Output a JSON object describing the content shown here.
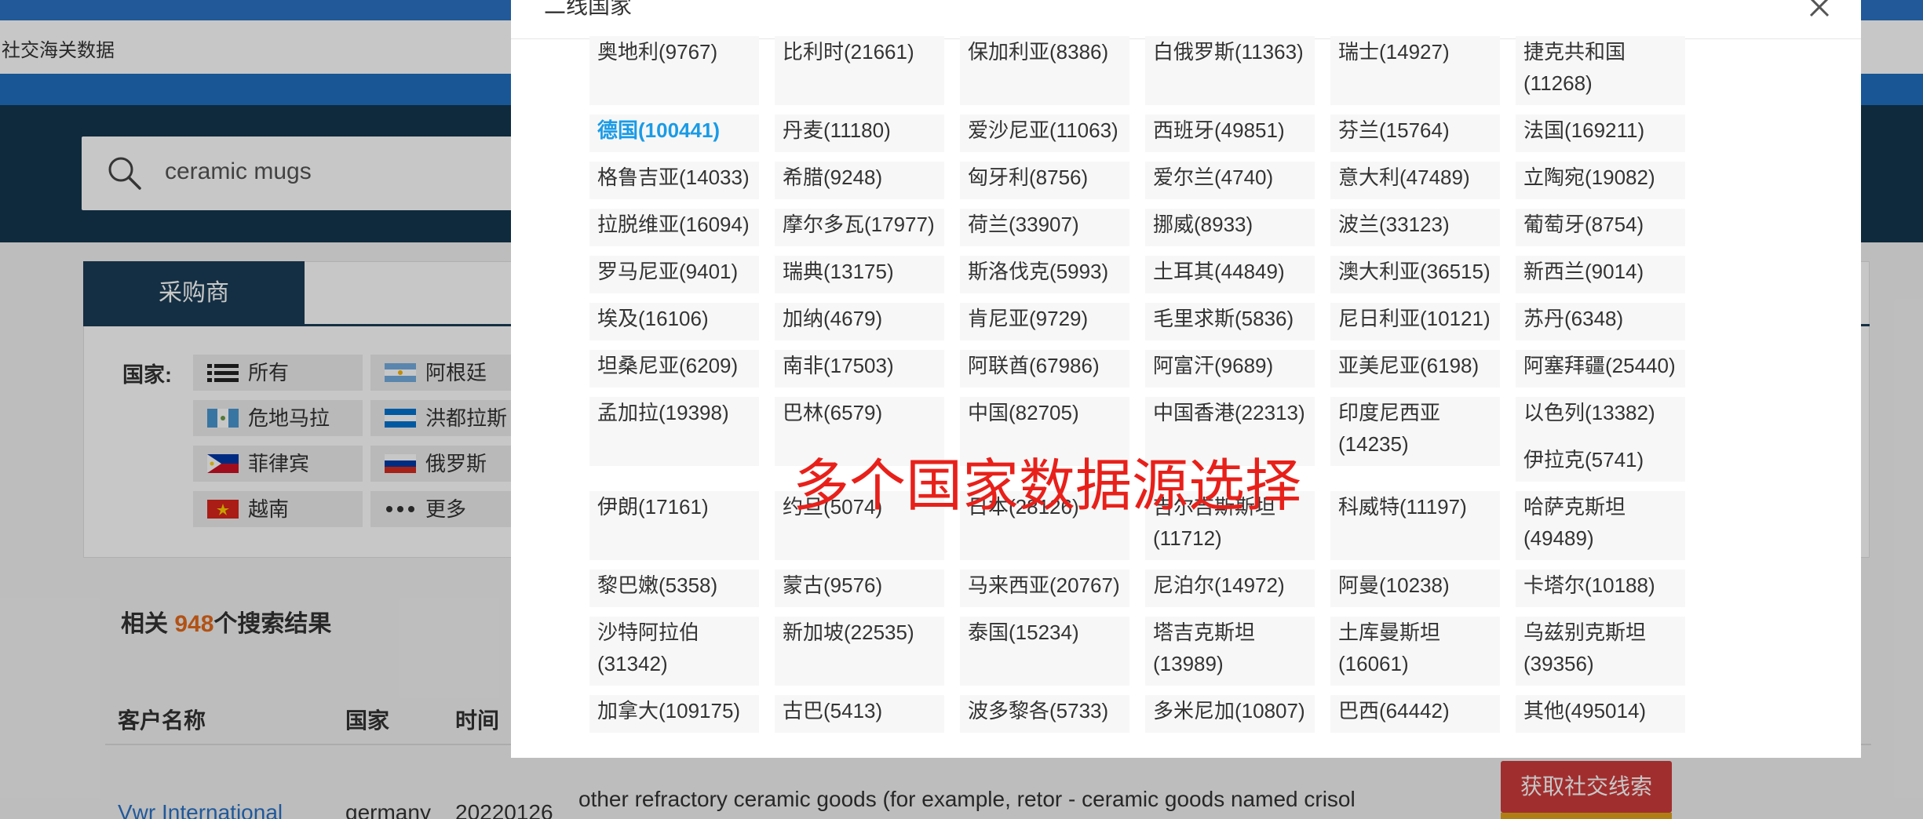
{
  "nav": {
    "text": "社交海关数据"
  },
  "search": {
    "value": "ceramic mugs"
  },
  "tabs": {
    "buyers": "采购商"
  },
  "filter": {
    "label": "国家:",
    "chips": [
      "所有",
      "阿根廷",
      "危地马拉",
      "洪都拉斯",
      "菲律宾",
      "俄罗斯",
      "越南",
      "更多"
    ]
  },
  "results": {
    "prefix": "相关 ",
    "count": "948",
    "suffix": "个搜索结果"
  },
  "table": {
    "headers": [
      "客户名称",
      "国家",
      "时间"
    ],
    "row": {
      "name": "Vwr International",
      "country": "germany",
      "date": "20220126",
      "desc": "other refractory ceramic goods (for example, retor - ceramic goods named crisol"
    },
    "social_button": "获取社交线索"
  },
  "modal": {
    "title": "二线国家",
    "annotation": "多个国家数据源选择",
    "active_color": "#1a9be6",
    "countries": [
      [
        "奥地利(9767)",
        "比利时(21661)",
        "保加利亚(8386)",
        "白俄罗斯(11363)",
        "瑞士(14927)",
        "捷克共和国(11268)"
      ],
      [
        "德国(100441)",
        "丹麦(11180)",
        "爱沙尼亚(11063)",
        "西班牙(49851)",
        "芬兰(15764)",
        "法国(169211)"
      ],
      [
        "格鲁吉亚(14033)",
        "希腊(9248)",
        "匈牙利(8756)",
        "爱尔兰(4740)",
        "意大利(47489)",
        "立陶宛(19082)"
      ],
      [
        "拉脱维亚(16094)",
        "摩尔多瓦(17977)",
        "荷兰(33907)",
        "挪威(8933)",
        "波兰(33123)",
        "葡萄牙(8754)"
      ],
      [
        "罗马尼亚(9401)",
        "瑞典(13175)",
        "斯洛伐克(5993)",
        "土耳其(44849)",
        "澳大利亚(36515)",
        "新西兰(9014)"
      ],
      [
        "埃及(16106)",
        "加纳(4679)",
        "肯尼亚(9729)",
        "毛里求斯(5836)",
        "尼日利亚(10121)",
        "苏丹(6348)"
      ],
      [
        "坦桑尼亚(6209)",
        "南非(17503)",
        "阿联酋(67986)",
        "阿富汗(9689)",
        "亚美尼亚(6198)",
        "阿塞拜疆(25440)"
      ],
      [
        "孟加拉(19398)",
        "巴林(6579)",
        "中国(82705)",
        "中国香港(22313)",
        "印度尼西亚(14235)",
        "以色列(13382)"
      ],
      [
        "",
        "",
        "",
        "",
        "",
        "伊拉克(5741)"
      ],
      [
        "伊朗(17161)",
        "约旦(5074)",
        "日本(28126)",
        "吉尔吉斯斯坦(11712)",
        "科威特(11197)",
        "哈萨克斯坦(49489)"
      ],
      [
        "黎巴嫩(5358)",
        "蒙古(9576)",
        "马来西亚(20767)",
        "尼泊尔(14972)",
        "阿曼(10238)",
        "卡塔尔(10188)"
      ],
      [
        "沙特阿拉伯(31342)",
        "新加坡(22535)",
        "泰国(15234)",
        "塔吉克斯坦(13989)",
        "土库曼斯坦(16061)",
        "乌兹别克斯坦(39356)"
      ],
      [
        "加拿大(109175)",
        "古巴(5413)",
        "波多黎各(5733)",
        "多米尼加(10807)",
        "巴西(64442)",
        "其他(495014)"
      ]
    ]
  }
}
